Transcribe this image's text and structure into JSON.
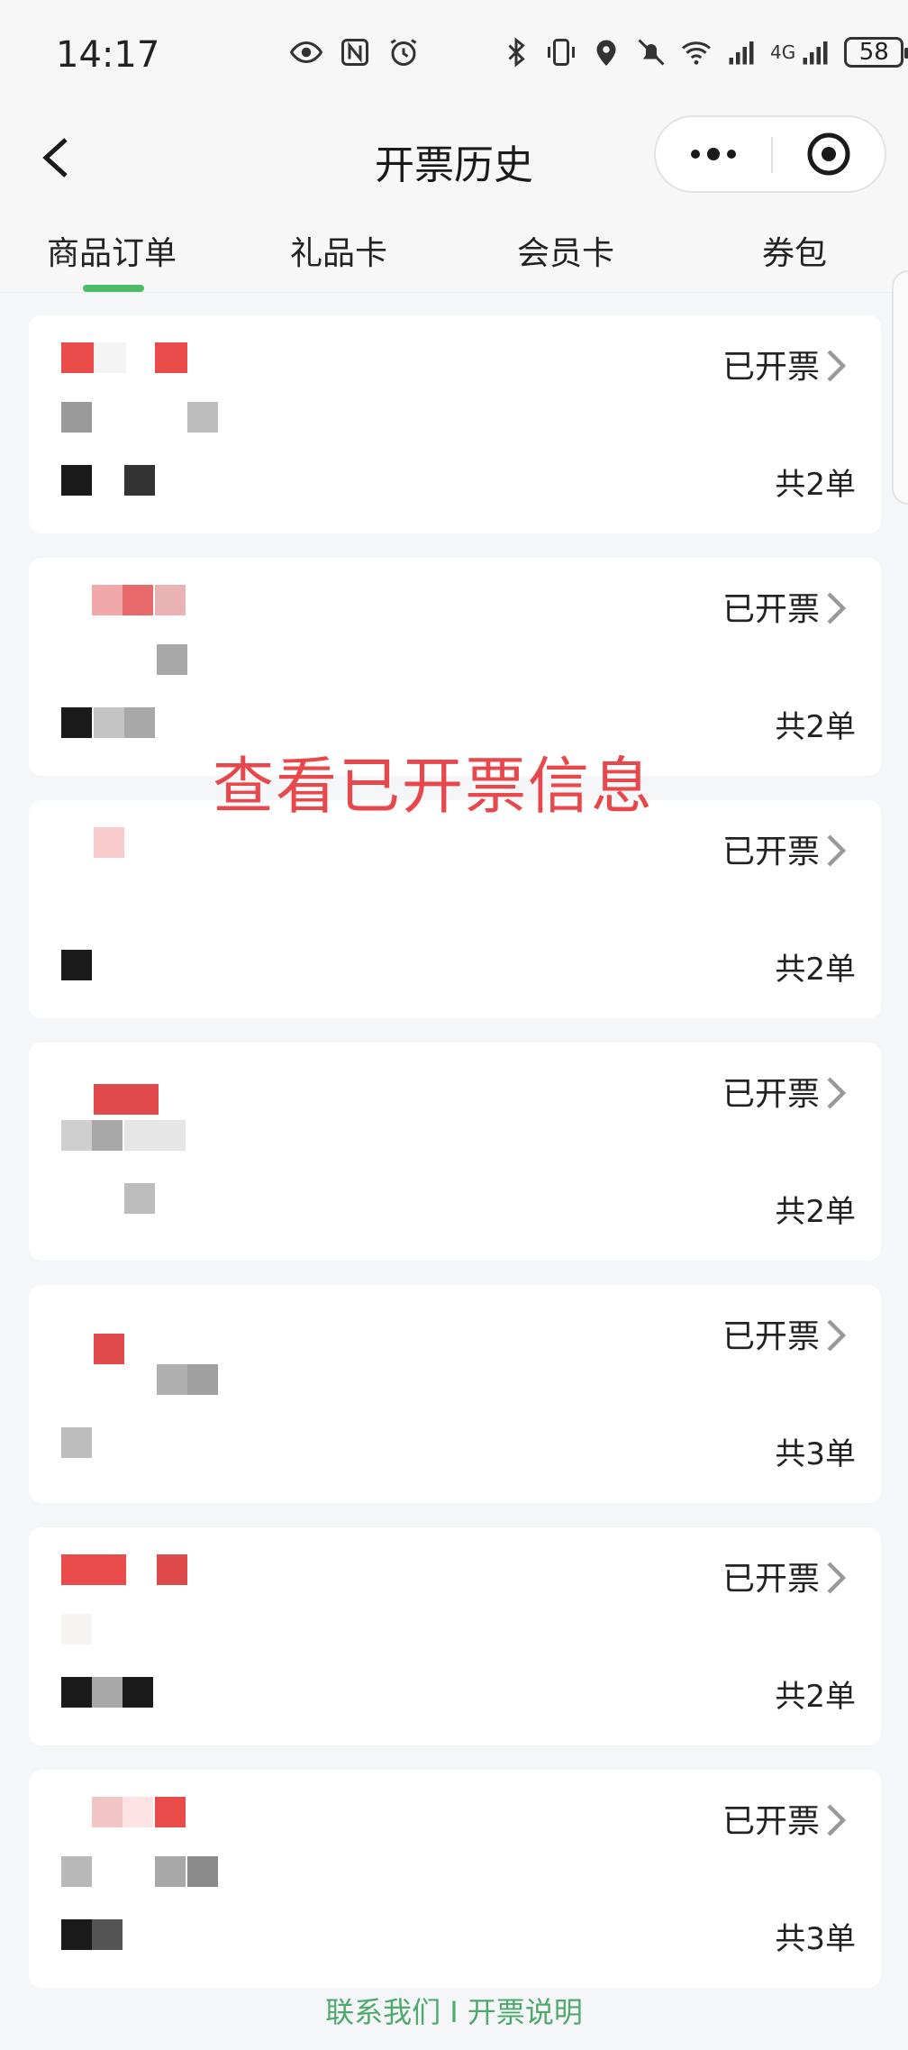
{
  "status_bar": {
    "time": "14:17",
    "network": "4G",
    "battery": "58",
    "icons_left": [
      "eye-icon",
      "nfc-icon",
      "alarm-icon"
    ],
    "icons_right": [
      "bluetooth-icon",
      "vibrate-icon",
      "location-icon",
      "mute-icon",
      "wifi-icon",
      "signal-icon",
      "signal-4g-icon"
    ]
  },
  "nav": {
    "title": "开票历史",
    "back_icon": "chevron-left-icon",
    "more_icon": "more-dots-icon",
    "close_icon": "target-close-icon"
  },
  "tabs": [
    {
      "label": "商品订单",
      "active": true
    },
    {
      "label": "礼品卡",
      "active": false
    },
    {
      "label": "会员卡",
      "active": false
    },
    {
      "label": "券包",
      "active": false
    }
  ],
  "accent_color": "#4cbc6a",
  "overlay_annotation": "查看已开票信息",
  "cards": [
    {
      "status": "已开票",
      "count": "共2单"
    },
    {
      "status": "已开票",
      "count": "共2单"
    },
    {
      "status": "已开票",
      "count": "共2单"
    },
    {
      "status": "已开票",
      "count": "共2单"
    },
    {
      "status": "已开票",
      "count": "共3单"
    },
    {
      "status": "已开票",
      "count": "共2单"
    },
    {
      "status": "已开票",
      "count": "共3单"
    }
  ],
  "footer": "联系我们 I 开票说明"
}
